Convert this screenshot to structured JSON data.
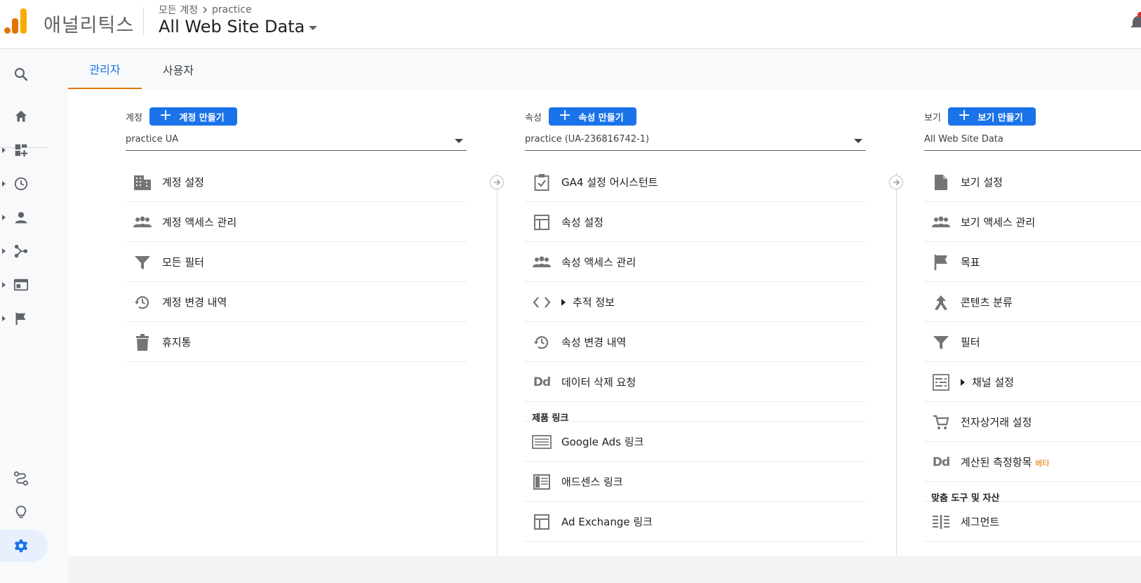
{
  "header": {
    "app_name": "애널리틱스",
    "breadcrumb": {
      "root": "모든 계정",
      "account": "practice"
    },
    "view_title": "All Web Site Data"
  },
  "tabs": [
    {
      "label": "관리자",
      "active": true
    },
    {
      "label": "사용자",
      "active": false
    }
  ],
  "account_col": {
    "label": "계정",
    "create_label": "계정 만들기",
    "selected": "practice UA",
    "items": [
      {
        "label": "계정 설정",
        "icon": "building-icon"
      },
      {
        "label": "계정 액세스 관리",
        "icon": "people-icon"
      },
      {
        "label": "모든 필터",
        "icon": "filter-icon"
      },
      {
        "label": "계정 변경 내역",
        "icon": "history-icon"
      },
      {
        "label": "휴지통",
        "icon": "trash-icon"
      }
    ]
  },
  "property_col": {
    "label": "속성",
    "create_label": "속성 만들기",
    "selected": "practice (UA-236816742-1)",
    "items": [
      {
        "label": "GA4 설정 어시스턴트",
        "icon": "checklist-icon"
      },
      {
        "label": "속성 설정",
        "icon": "layout-icon"
      },
      {
        "label": "속성 액세스 관리",
        "icon": "people-icon"
      },
      {
        "label": "추적 정보",
        "icon": "code-icon",
        "expandable": true
      },
      {
        "label": "속성 변경 내역",
        "icon": "history-icon"
      },
      {
        "label": "데이터 삭제 요청",
        "icon": "dd-icon"
      }
    ],
    "section_title": "제품 링크",
    "links": [
      {
        "label": "Google Ads 링크",
        "icon": "ads-icon"
      },
      {
        "label": "애드센스 링크",
        "icon": "adsense-icon"
      },
      {
        "label": "Ad Exchange 링크",
        "icon": "adexchange-icon"
      }
    ]
  },
  "view_col": {
    "label": "보기",
    "create_label": "보기 만들기",
    "selected": "All Web Site Data",
    "items": [
      {
        "label": "보기 설정",
        "icon": "document-icon"
      },
      {
        "label": "보기 액세스 관리",
        "icon": "people-icon"
      },
      {
        "label": "목표",
        "icon": "flag-icon"
      },
      {
        "label": "콘텐츠 분류",
        "icon": "grouping-icon"
      },
      {
        "label": "필터",
        "icon": "filter-icon"
      },
      {
        "label": "채널 설정",
        "icon": "channel-icon",
        "expandable": true
      },
      {
        "label": "전자상거래 설정",
        "icon": "cart-icon"
      },
      {
        "label": "계산된 측정항목",
        "icon": "dd-icon",
        "badge": "베타"
      }
    ],
    "section_title": "맞춤 도구 및 자산",
    "tools": [
      {
        "label": "세그먼트",
        "icon": "segment-icon"
      }
    ]
  },
  "colors": {
    "accent_blue": "#1a73e8",
    "tab_underline": "#e37400",
    "beta_badge": "#e37400"
  }
}
